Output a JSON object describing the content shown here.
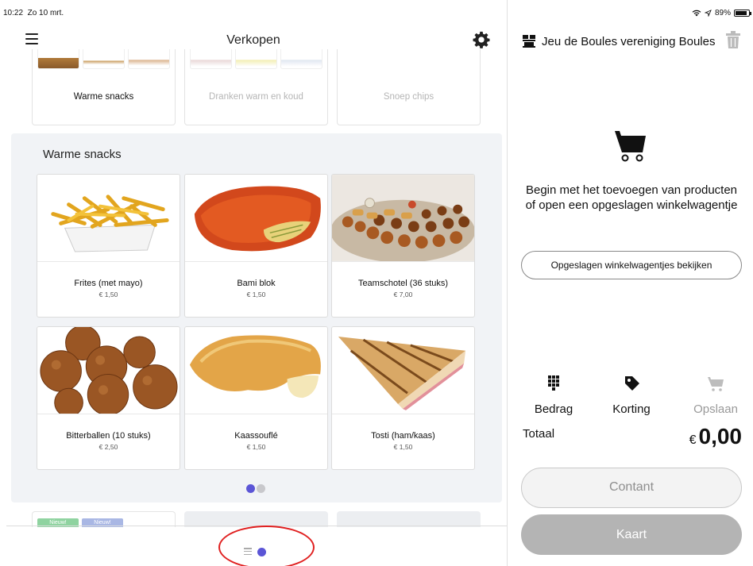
{
  "status": {
    "time": "10:22",
    "date": "Zo 10 mrt.",
    "battery": "89%"
  },
  "header": {
    "title": "Verkopen"
  },
  "categories": [
    {
      "label": "Warme snacks",
      "active": true
    },
    {
      "label": "Dranken warm en koud",
      "active": false
    },
    {
      "label": "Snoep chips",
      "active": false
    }
  ],
  "section": {
    "title": "Warme snacks"
  },
  "products": [
    {
      "name": "Frites  (met mayo)",
      "price": "€ 1,50"
    },
    {
      "name": "Bami blok",
      "price": "€ 1,50"
    },
    {
      "name": "Teamschotel (36 stuks)",
      "price": "€ 7,00"
    },
    {
      "name": "Bitterballen (10 stuks)",
      "price": "€ 2,50"
    },
    {
      "name": "Kaassouflé",
      "price": "€ 1,50"
    },
    {
      "name": "Tosti (ham/kaas)",
      "price": "€ 1,50"
    }
  ],
  "bottom_tags": [
    "Nieuw!",
    "Nieuw!"
  ],
  "cart": {
    "shop_name": "Jeu de Boules vereniging Boules",
    "empty_message": "Begin met het toevoegen van producten of open een opgeslagen winkelwagentje",
    "saved_button": "Opgeslagen winkelwagentjes bekijken",
    "actions": {
      "amount": "Bedrag",
      "discount": "Korting",
      "save": "Opslaan"
    },
    "total_label": "Totaal",
    "currency": "€",
    "total": "0,00",
    "cash_button": "Contant",
    "card_button": "Kaart"
  },
  "colors": {
    "accent": "#5b55d6",
    "annotation": "#e02020",
    "panel_bg": "#f1f3f6"
  }
}
